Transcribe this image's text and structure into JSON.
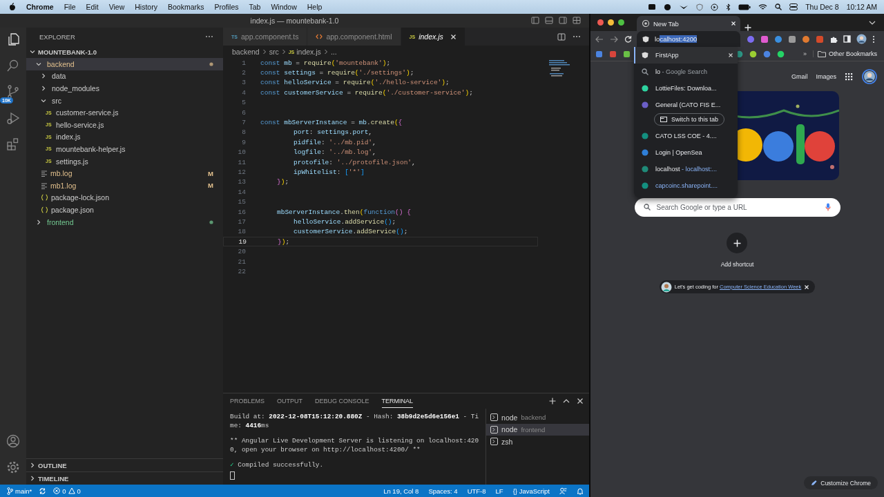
{
  "menubar": {
    "app": "Chrome",
    "menus": [
      "File",
      "Edit",
      "View",
      "History",
      "Bookmarks",
      "Profiles",
      "Tab",
      "Window",
      "Help"
    ],
    "date": "Thu Dec 8",
    "time": "10:12 AM"
  },
  "vscode": {
    "title": "index.js — mountebank-1.0",
    "source_control_badge": "10K",
    "explorer": {
      "title": "EXPLORER",
      "workspace": {
        "label": "MOUNTEBANK-1.0",
        "expanded": true
      },
      "tree": [
        {
          "label": "backend",
          "kind": "folder",
          "expanded": true,
          "selected": true,
          "modified": true,
          "untracked": false,
          "children": [
            {
              "label": "data",
              "kind": "folder",
              "expanded": false,
              "selected": false,
              "modified": false,
              "untracked": false
            },
            {
              "label": "node_modules",
              "kind": "folder",
              "expanded": false,
              "selected": false,
              "modified": false,
              "untracked": false
            },
            {
              "label": "src",
              "kind": "folder",
              "expanded": true,
              "selected": false,
              "modified": false,
              "untracked": false,
              "children": [
                {
                  "label": "customer-service.js",
                  "kind": "js",
                  "icon": "JS",
                  "selected": false,
                  "modified": false,
                  "untracked": false
                },
                {
                  "label": "hello-service.js",
                  "kind": "js",
                  "icon": "JS",
                  "selected": false,
                  "modified": false,
                  "untracked": false
                },
                {
                  "label": "index.js",
                  "kind": "js",
                  "icon": "JS",
                  "selected": false,
                  "modified": false,
                  "untracked": false
                },
                {
                  "label": "mountebank-helper.js",
                  "kind": "js",
                  "icon": "JS",
                  "selected": false,
                  "modified": false,
                  "untracked": false
                },
                {
                  "label": "settings.js",
                  "kind": "js",
                  "icon": "JS",
                  "selected": false,
                  "modified": false,
                  "untracked": false
                }
              ]
            },
            {
              "label": "mb.log",
              "kind": "log",
              "selected": false,
              "modified": true,
              "untracked": false,
              "badge": "M"
            },
            {
              "label": "mb1.log",
              "kind": "log",
              "selected": false,
              "modified": true,
              "untracked": false,
              "badge": "M"
            },
            {
              "label": "package-lock.json",
              "kind": "json",
              "selected": false,
              "modified": false,
              "untracked": false
            },
            {
              "label": "package.json",
              "kind": "json",
              "selected": false,
              "modified": false,
              "untracked": false
            }
          ]
        },
        {
          "label": "frontend",
          "kind": "folder",
          "expanded": false,
          "selected": false,
          "modified": false,
          "untracked": true
        }
      ],
      "sections": [
        {
          "label": "OUTLINE",
          "expanded": false
        },
        {
          "label": "TIMELINE",
          "expanded": false
        }
      ]
    },
    "tabs": [
      {
        "label": "app.component.ts",
        "kind": "ts",
        "icon": "TS",
        "selected": false
      },
      {
        "label": "app.component.html",
        "kind": "html",
        "selected": false
      },
      {
        "label": "index.js",
        "kind": "js",
        "icon": "JS",
        "selected": true
      }
    ],
    "breadcrumb": [
      {
        "label": "backend",
        "kind": "folder"
      },
      {
        "label": "src",
        "kind": "folder"
      },
      {
        "label": "index.js",
        "kind": "js",
        "icon": "JS"
      },
      {
        "label": "...",
        "kind": "more"
      }
    ],
    "code": [
      {
        "n": "1",
        "current": false,
        "tokens": [
          {
            "text": "const ",
            "kind": "keyword"
          },
          {
            "text": "mb",
            "kind": "variable"
          },
          {
            "text": " = ",
            "kind": "plain"
          },
          {
            "text": "require",
            "kind": "function"
          },
          {
            "text": "(",
            "kind": "paren"
          },
          {
            "text": "'mountebank'",
            "kind": "string"
          },
          {
            "text": ")",
            "kind": "paren"
          },
          {
            "text": ";",
            "kind": "plain"
          }
        ]
      },
      {
        "n": "2",
        "current": false,
        "tokens": [
          {
            "text": "const ",
            "kind": "keyword"
          },
          {
            "text": "settings",
            "kind": "variable"
          },
          {
            "text": " = ",
            "kind": "plain"
          },
          {
            "text": "require",
            "kind": "function"
          },
          {
            "text": "(",
            "kind": "paren"
          },
          {
            "text": "'./settings'",
            "kind": "string"
          },
          {
            "text": ")",
            "kind": "paren"
          },
          {
            "text": ";",
            "kind": "plain"
          }
        ]
      },
      {
        "n": "3",
        "current": false,
        "tokens": [
          {
            "text": "const ",
            "kind": "keyword"
          },
          {
            "text": "helloService",
            "kind": "variable"
          },
          {
            "text": " = ",
            "kind": "plain"
          },
          {
            "text": "require",
            "kind": "function"
          },
          {
            "text": "(",
            "kind": "paren"
          },
          {
            "text": "'./hello-service'",
            "kind": "string"
          },
          {
            "text": ")",
            "kind": "paren"
          },
          {
            "text": ";",
            "kind": "plain"
          }
        ]
      },
      {
        "n": "4",
        "current": false,
        "tokens": [
          {
            "text": "const ",
            "kind": "keyword"
          },
          {
            "text": "customerService",
            "kind": "variable"
          },
          {
            "text": " = ",
            "kind": "plain"
          },
          {
            "text": "require",
            "kind": "function"
          },
          {
            "text": "(",
            "kind": "paren"
          },
          {
            "text": "'./customer-service'",
            "kind": "string"
          },
          {
            "text": ")",
            "kind": "paren"
          },
          {
            "text": ";",
            "kind": "plain"
          }
        ]
      },
      {
        "n": "5",
        "current": false
      },
      {
        "n": "6",
        "current": false
      },
      {
        "n": "7",
        "current": false,
        "tokens": [
          {
            "text": "const ",
            "kind": "keyword"
          },
          {
            "text": "mbServerInstance",
            "kind": "variable"
          },
          {
            "text": " = ",
            "kind": "plain"
          },
          {
            "text": "mb",
            "kind": "variable"
          },
          {
            "text": ".",
            "kind": "plain"
          },
          {
            "text": "create",
            "kind": "function"
          },
          {
            "text": "(",
            "kind": "paren"
          },
          {
            "text": "{",
            "kind": "brace"
          }
        ]
      },
      {
        "n": "8",
        "current": false,
        "kind": "innermost",
        "tokens": [
          {
            "text": "port",
            "kind": "variable"
          },
          {
            "text": ": ",
            "kind": "plain"
          },
          {
            "text": "settings",
            "kind": "variable"
          },
          {
            "text": ".",
            "kind": "plain"
          },
          {
            "text": "port",
            "kind": "variable"
          },
          {
            "text": ",",
            "kind": "plain"
          }
        ]
      },
      {
        "n": "9",
        "current": false,
        "kind": "innermost",
        "tokens": [
          {
            "text": "pidfile",
            "kind": "variable"
          },
          {
            "text": ": ",
            "kind": "plain"
          },
          {
            "text": "'../mb.pid'",
            "kind": "string"
          },
          {
            "text": ",",
            "kind": "plain"
          }
        ]
      },
      {
        "n": "10",
        "current": false,
        "kind": "innermost",
        "tokens": [
          {
            "text": "logfile",
            "kind": "variable"
          },
          {
            "text": ": ",
            "kind": "plain"
          },
          {
            "text": "'../mb.log'",
            "kind": "string"
          },
          {
            "text": ",",
            "kind": "plain"
          }
        ]
      },
      {
        "n": "11",
        "current": false,
        "kind": "innermost",
        "tokens": [
          {
            "text": "protofile",
            "kind": "variable"
          },
          {
            "text": ": ",
            "kind": "plain"
          },
          {
            "text": "'../protofile.json'",
            "kind": "string"
          },
          {
            "text": ",",
            "kind": "plain"
          }
        ]
      },
      {
        "n": "12",
        "current": false,
        "kind": "innermost",
        "tokens": [
          {
            "text": "ipWhitelist",
            "kind": "variable"
          },
          {
            "text": ": ",
            "kind": "plain"
          },
          {
            "text": "[",
            "kind": "square"
          },
          {
            "text": "'*'",
            "kind": "string"
          },
          {
            "text": "]",
            "kind": "square"
          }
        ]
      },
      {
        "n": "13",
        "current": false,
        "kind": "inner",
        "tokens": [
          {
            "text": "}",
            "kind": "brace"
          },
          {
            "text": ")",
            "kind": "paren"
          },
          {
            "text": ";",
            "kind": "plain"
          }
        ]
      },
      {
        "n": "14",
        "current": false
      },
      {
        "n": "15",
        "current": false
      },
      {
        "n": "16",
        "current": false,
        "kind": "inner",
        "tokens": [
          {
            "text": "mbServerInstance",
            "kind": "variable"
          },
          {
            "text": ".",
            "kind": "plain"
          },
          {
            "text": "then",
            "kind": "function"
          },
          {
            "text": "(",
            "kind": "paren"
          },
          {
            "text": "function",
            "kind": "keyword"
          },
          {
            "text": "()",
            "kind": "brace"
          },
          {
            "text": " {",
            "kind": "brace"
          }
        ]
      },
      {
        "n": "17",
        "current": false,
        "kind": "innermost",
        "tokens": [
          {
            "text": "helloService",
            "kind": "variable"
          },
          {
            "text": ".",
            "kind": "plain"
          },
          {
            "text": "addService",
            "kind": "function"
          },
          {
            "text": "()",
            "kind": "square"
          },
          {
            "text": ";",
            "kind": "plain"
          }
        ]
      },
      {
        "n": "18",
        "current": false,
        "kind": "innermost",
        "tokens": [
          {
            "text": "customerService",
            "kind": "variable"
          },
          {
            "text": ".",
            "kind": "plain"
          },
          {
            "text": "addService",
            "kind": "function"
          },
          {
            "text": "()",
            "kind": "square"
          },
          {
            "text": ";",
            "kind": "plain"
          }
        ]
      },
      {
        "n": "19",
        "current": true,
        "kind": "inner",
        "tokens": [
          {
            "text": "}",
            "kind": "brace"
          },
          {
            "text": ")",
            "kind": "paren"
          },
          {
            "text": ";",
            "kind": "plain"
          }
        ]
      },
      {
        "n": "20",
        "current": false
      },
      {
        "n": "21",
        "current": false
      },
      {
        "n": "22",
        "current": false
      }
    ],
    "panel": {
      "tabs": [
        {
          "label": "PROBLEMS",
          "selected": false
        },
        {
          "label": "OUTPUT",
          "selected": false
        },
        {
          "label": "DEBUG CONSOLE",
          "selected": false
        },
        {
          "label": "TERMINAL",
          "selected": true
        }
      ],
      "terminal": [
        [
          {
            "segments": [
              {
                "text": "Build at: ",
                "bold": false
              },
              {
                "text": "2022-12-08T15:12:20.880Z",
                "bold": true
              },
              {
                "text": " - Hash: ",
                "bold": false
              },
              {
                "text": "38b9d2e5d6e156e1",
                "bold": true
              },
              {
                "text": " - Ti",
                "bold": false
              }
            ]
          },
          {
            "segments": [
              {
                "text": "me: ",
                "bold": false
              },
              {
                "text": "4416",
                "bold": true
              },
              {
                "text": "ms",
                "bold": false
              }
            ]
          }
        ],
        [
          {
            "segments": [
              {
                "text": "** Angular Live Development Server is listening on localhost:420",
                "bold": false
              }
            ]
          },
          {
            "segments": [
              {
                "text": "0, open your browser on http://localhost:4200/ **",
                "bold": false
              }
            ]
          }
        ],
        [
          {
            "segments": [
              {
                "text": "✓",
                "bold": false,
                "kind": "success"
              },
              {
                "text": " Compiled successfully.",
                "bold": false
              }
            ]
          }
        ]
      ],
      "sessions": [
        {
          "name": "node",
          "detail": "backend",
          "selected": false
        },
        {
          "name": "node",
          "detail": "frontend",
          "selected": true
        },
        {
          "name": "zsh",
          "selected": false
        }
      ]
    },
    "status_bar": {
      "branch": "main*",
      "errors": "0",
      "warnings": "0",
      "items": [
        "Ln 19, Col 8",
        "Spaces: 4",
        "UTF-8",
        "LF"
      ],
      "language_icon": "{}",
      "language": "JavaScript"
    }
  },
  "chrome": {
    "tab": {
      "title": "New Tab"
    },
    "omnibox": {
      "typed": "lo",
      "completion": "calhost:4200"
    },
    "suggestions": [
      {
        "kind": "app",
        "title": "FirstApp",
        "selected": true
      },
      {
        "kind": "search",
        "title": "lo",
        "detail": " - Google Search",
        "selected": false
      },
      {
        "kind": "site",
        "color": "#2ed3a0",
        "title": "LottieFiles: Downloa...",
        "selected": false
      },
      {
        "kind": "site",
        "color": "#6b5fc7",
        "title": "General (CATO FIS E...",
        "action": "Switch to this tab",
        "selected": false
      },
      {
        "kind": "site",
        "color": "#138f7f",
        "title": "CATO LSS COE - 4....",
        "selected": false
      },
      {
        "kind": "site",
        "color": "#2f7fd8",
        "title": "Login | OpenSea",
        "selected": false
      },
      {
        "kind": "site",
        "color": "#1f8a78",
        "title": "localhost",
        "detail": " - localhost:...",
        "detail_is_url": true,
        "selected": false
      },
      {
        "kind": "site",
        "color": "#138f7f",
        "title": "capcoinc.sharepoint....",
        "title_is_url": true,
        "selected": false
      }
    ],
    "bookmarks": {
      "overflow": "»",
      "other": "Other Bookmarks"
    },
    "ntp": {
      "links": [
        "Gmail",
        "Images"
      ],
      "search_placeholder": "Search Google or type a URL",
      "shortcut": "Add shortcut",
      "promo": {
        "text": "Let's get coding for ",
        "link": "Computer Science Education Week"
      },
      "customize": "Customize Chrome"
    }
  }
}
